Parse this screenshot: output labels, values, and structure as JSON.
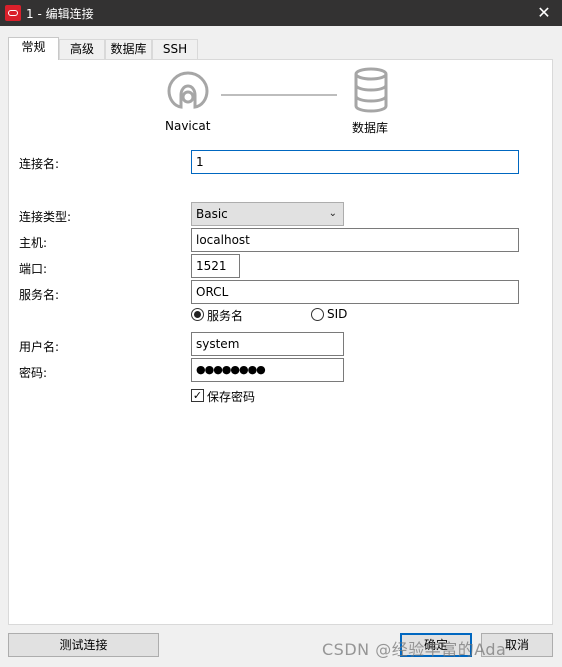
{
  "window": {
    "title": "1 - 编辑连接",
    "close_glyph": "✕"
  },
  "tabs": [
    {
      "label": "常规",
      "active": true
    },
    {
      "label": "高级",
      "active": false
    },
    {
      "label": "数据库",
      "active": false
    },
    {
      "label": "SSH",
      "active": false
    }
  ],
  "diagram": {
    "left_label": "Navicat",
    "right_label": "数据库",
    "left_icon": "navicat-icon",
    "right_icon": "database-icon"
  },
  "form": {
    "connection_name_label": "连接名:",
    "connection_name_value": "1",
    "connection_type_label": "连接类型:",
    "connection_type_value": "Basic",
    "host_label": "主机:",
    "host_value": "localhost",
    "port_label": "端口:",
    "port_value": "1521",
    "service_name_label": "服务名:",
    "service_name_value": "ORCL",
    "radio_service_name": "服务名",
    "radio_sid": "SID",
    "radio_selected": "服务名",
    "username_label": "用户名:",
    "username_value": "system",
    "password_label": "密码:",
    "password_mask": "●●●●●●●●",
    "save_password_label": "保存密码",
    "save_password_checked": true
  },
  "buttons": {
    "test_connection": "测试连接",
    "ok": "确定",
    "cancel": "取消"
  },
  "watermark": "CSDN @经验丰富的Ada",
  "colors": {
    "title_bar": "#333232",
    "accent": "#0067c0",
    "app_icon": "#d9202b"
  }
}
